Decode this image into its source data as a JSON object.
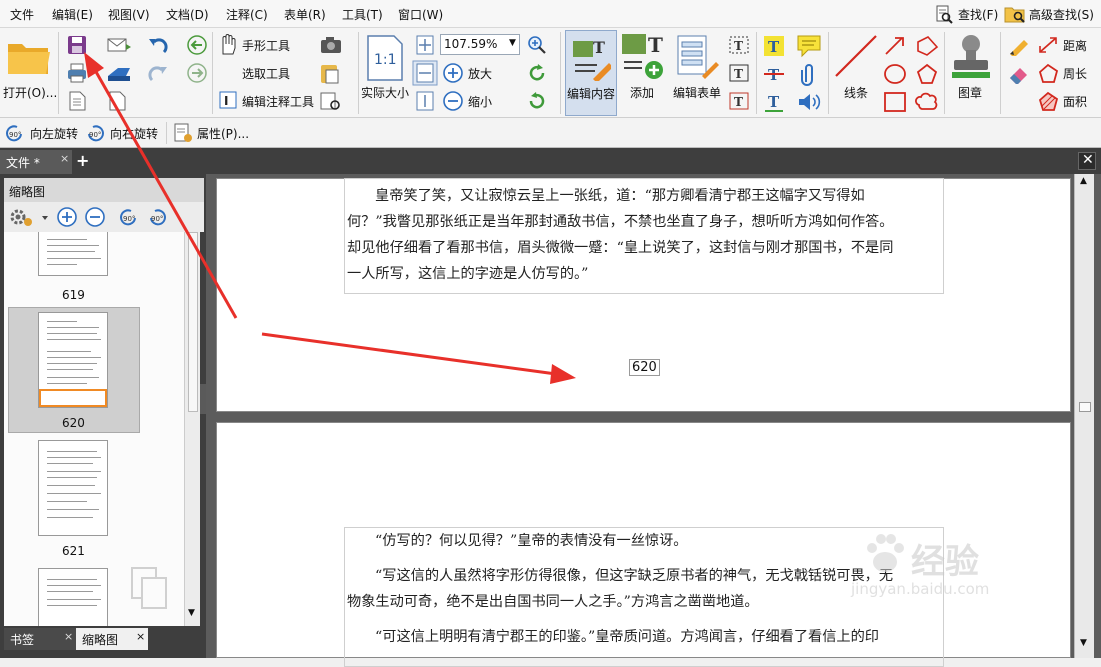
{
  "menu": {
    "file": "文件",
    "edit": "编辑(E)",
    "view": "视图(V)",
    "document": "文档(D)",
    "comment": "注释(C)",
    "form": "表单(R)",
    "tools": "工具(T)",
    "window": "窗口(W)",
    "find": "查找(F)",
    "advanced_find": "高级查找(S)"
  },
  "ribbon": {
    "open": "打开(O)...",
    "hand_tool": "手形工具",
    "select_tool": "选取工具",
    "edit_annot_tool": "编辑注释工具",
    "actual_size": "实际大小",
    "zoom_value": "107.59%",
    "zoom_in": "放大",
    "zoom_out": "缩小",
    "edit_content": "编辑内容",
    "add": "添加",
    "edit_form": "编辑表单",
    "lines": "线条",
    "stamp": "图章",
    "distance": "距离",
    "perimeter": "周长",
    "area": "面积",
    "rotate_left": "向左旋转",
    "rotate_right": "向右旋转",
    "properties": "属性(P)..."
  },
  "tabs": {
    "doc_tab": "文件 *"
  },
  "left_panel": {
    "title": "缩略图",
    "thumbs": [
      {
        "page": "619"
      },
      {
        "page": "620"
      },
      {
        "page": "621"
      }
    ],
    "bottom_tabs": [
      "书签",
      "缩略图"
    ]
  },
  "document": {
    "page_label": "620",
    "top_paragraph": [
      "皇帝笑了笑，又让寂惊云呈上一张纸，道：“那方卿看清宁郡王这幅字又写得如",
      "何？”我瞥见那张纸正是当年那封通敌书信，不禁也坐直了身子，想听听方鸿如何作答。",
      "却见他仔细看了看那书信，眉头微微一蹙：“皇上说笑了，这封信与刚才那国书，不是同",
      "一人所写，这信上的字迹是人仿写的。”"
    ],
    "bottom_paragraphs": [
      "“仿写的？何以见得？”皇帝的表情没有一丝惊讶。",
      "“写这信的人虽然将字形仿得很像，但这字缺乏原书者的神气，无戈戟铦锐可畏，无",
      "物象生动可奇，绝不是出自国书同一人之手。”方鸿言之凿凿地道。",
      "“可这信上明明有清宁郡王的印鉴。”皇帝质问道。方鸿闻言，仔细看了看信上的印"
    ]
  },
  "watermark": {
    "brand": "经验",
    "url": "jingyan.baidu.com"
  },
  "colors": {
    "accent_arrow": "#e8302a",
    "dark_panel": "#3e3e3e"
  }
}
